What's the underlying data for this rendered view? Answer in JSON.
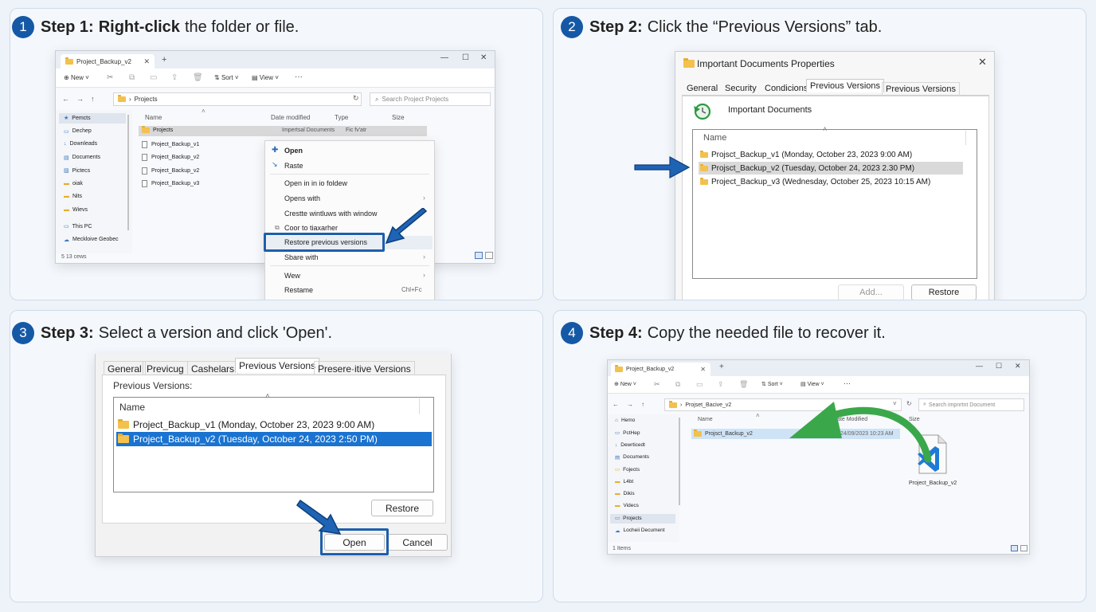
{
  "steps": [
    {
      "num": "1",
      "bold": "Step 1:",
      "bold2": "Right-click",
      "text": "the folder or file."
    },
    {
      "num": "2",
      "bold": "Step 2:",
      "text": "Click the “Previous Versions” tab."
    },
    {
      "num": "3",
      "bold": "Step 3:",
      "text": "Select a version and click 'Open'."
    },
    {
      "num": "4",
      "bold": "Step 4:",
      "text": "Copy the needed file to recover it."
    }
  ],
  "panel1": {
    "tab_title": "Project_Backup_v2",
    "toolbar": {
      "new": "New",
      "sort": "Sort",
      "view": "View",
      "more": "···"
    },
    "address": "Projects",
    "search": "Search Project Projects",
    "columns": [
      "Name",
      "Date modified",
      "Type",
      "Size"
    ],
    "sidebar": [
      "Pemcts",
      "Dechep",
      "Downleads",
      "Documents",
      "Pictecs",
      "oiak",
      "Nits",
      "Wievs",
      "This PC",
      "Meckloive Geobec"
    ],
    "files": [
      {
        "name": "Projects",
        "date": "Impertsal Documents",
        "type": "Fic fv'atr"
      },
      {
        "name": "Project_Backup_v1"
      },
      {
        "name": "Project_Backup_v2"
      },
      {
        "name": "Project_Backup_v2"
      },
      {
        "name": "Project_Backup_v3"
      }
    ],
    "status": "5 13 cews",
    "context_menu": [
      "Open",
      "Raste",
      "Open in in io foldew",
      "Opens with",
      "Crestte wintluws with window",
      "Coor to tiaxarher",
      "Restore previous versions",
      "Sbare with",
      "Wew",
      "Restame"
    ],
    "shortcut": "Chl+Fc"
  },
  "panel2": {
    "title": "Important Documents Properties",
    "tabs": [
      "General",
      "Security",
      "Condicions",
      "Previous Versions",
      "Previous Versions"
    ],
    "heading": "Important Documents",
    "column": "Name",
    "versions": [
      "Projsct_Backup_v1 (Monday, October 23, 2023 9:00 AM)",
      "Projsct_Backup_v2 (Tuesday, October 24, 2023 2.30 PM)",
      "Project_Backup_v3 (Wednesday, October 25, 2023 10:15 AM)"
    ],
    "add": "Add...",
    "restore": "Restore"
  },
  "panel3": {
    "tabs": [
      "General",
      "Previcug",
      "Cashelars",
      "Previous Versions",
      "Presere·itive Versions"
    ],
    "label": "Previous Versions:",
    "column": "Name",
    "versions": [
      "Project_Backup_v1 (Monday, October 23, 2023 9:00 AM)",
      "Project_Backup_v2 (Tuesday, October 24, 2023 2:50 PM)"
    ],
    "restore": "Restore",
    "open": "Open",
    "cancel": "Cancel"
  },
  "panel4": {
    "tab_title": "Project_Backup_v2",
    "toolbar": {
      "new": "New",
      "sort": "Sort",
      "view": "View",
      "more": "···"
    },
    "address": "Projset_Bacive_v2",
    "search": "Search impnrtnt Document",
    "columns": [
      "Name",
      "Date Modified",
      "Size"
    ],
    "sidebar": [
      "Hemo",
      "PctHep",
      "Dewrticedt",
      "Documents",
      "Fojects",
      "L4bt",
      "Dikis",
      "Videcs",
      "Projects",
      "Locheii Decument"
    ],
    "file_row": {
      "name": "Projsct_Backup_v2",
      "date": "24/09/2023 10:23 AM"
    },
    "doc_label": "Project_Backup_v2",
    "status": "1 Items"
  },
  "colors": {
    "accent": "#1559a6",
    "highlight_border": "#1d5fad",
    "selection": "#1a73d0",
    "green_arrow": "#3aa84a",
    "folder": "#f2c14e"
  }
}
